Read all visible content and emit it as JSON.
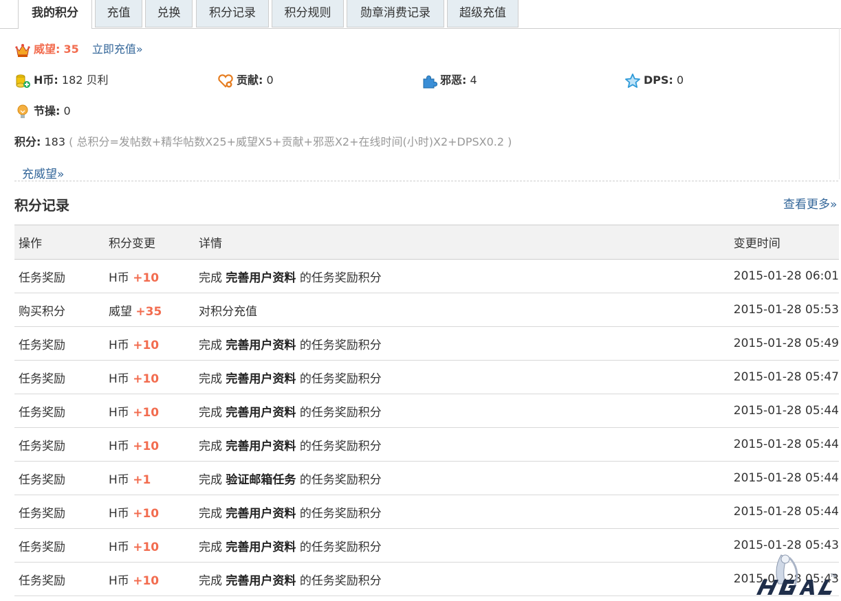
{
  "tabs": [
    "我的积分",
    "充值",
    "兑换",
    "积分记录",
    "积分规则",
    "勋章消费记录",
    "超级充值"
  ],
  "prestige": {
    "label": "威望:",
    "value": "35",
    "link": "立即充值»"
  },
  "credits": [
    {
      "icon": "coins-icon",
      "label": "H币:",
      "value": "182 贝利"
    },
    {
      "icon": "heart-contribution-icon",
      "label": "贡献:",
      "value": "0"
    },
    {
      "icon": "puzzle-icon",
      "label": "邪恶:",
      "value": "4"
    },
    {
      "icon": "star-icon",
      "label": "DPS:",
      "value": "0"
    }
  ],
  "integrity": {
    "icon": "lightbulb-icon",
    "label": "节操:",
    "value": "0"
  },
  "total": {
    "label": "积分:",
    "value": "183",
    "formula": "( 总积分=发帖数+精华帖数X25+威望X5+贡献+邪恶X2+在线时间(小时)X2+DPSX0.2 )"
  },
  "recharge_prestige_link": "充威望»",
  "log": {
    "title": "积分记录",
    "more": "查看更多»",
    "headers": [
      "操作",
      "积分变更",
      "详情",
      "变更时间"
    ],
    "rows": [
      {
        "op": "任务奖励",
        "type": "H币",
        "delta": "+10",
        "pre": "完成",
        "task": "完善用户资料",
        "post": "的任务奖励积分",
        "time": "2015-01-28 06:01"
      },
      {
        "op": "购买积分",
        "type": "威望",
        "delta": "+35",
        "pre": "对积分充值",
        "task": "",
        "post": "",
        "time": "2015-01-28 05:53"
      },
      {
        "op": "任务奖励",
        "type": "H币",
        "delta": "+10",
        "pre": "完成",
        "task": "完善用户资料",
        "post": "的任务奖励积分",
        "time": "2015-01-28 05:49"
      },
      {
        "op": "任务奖励",
        "type": "H币",
        "delta": "+10",
        "pre": "完成",
        "task": "完善用户资料",
        "post": "的任务奖励积分",
        "time": "2015-01-28 05:47"
      },
      {
        "op": "任务奖励",
        "type": "H币",
        "delta": "+10",
        "pre": "完成",
        "task": "完善用户资料",
        "post": "的任务奖励积分",
        "time": "2015-01-28 05:44"
      },
      {
        "op": "任务奖励",
        "type": "H币",
        "delta": "+10",
        "pre": "完成",
        "task": "完善用户资料",
        "post": "的任务奖励积分",
        "time": "2015-01-28 05:44"
      },
      {
        "op": "任务奖励",
        "type": "H币",
        "delta": "+1",
        "pre": "完成",
        "task": "验证邮箱任务",
        "post": "的任务奖励积分",
        "time": "2015-01-28 05:44"
      },
      {
        "op": "任务奖励",
        "type": "H币",
        "delta": "+10",
        "pre": "完成",
        "task": "完善用户资料",
        "post": "的任务奖励积分",
        "time": "2015-01-28 05:44"
      },
      {
        "op": "任务奖励",
        "type": "H币",
        "delta": "+10",
        "pre": "完成",
        "task": "完善用户资料",
        "post": "的任务奖励积分",
        "time": "2015-01-28 05:43"
      },
      {
        "op": "任务奖励",
        "type": "H币",
        "delta": "+10",
        "pre": "完成",
        "task": "完善用户资料",
        "post": "的任务奖励积分",
        "time": "2015-01-28 05:43"
      }
    ]
  },
  "watermark": "HGAL",
  "colors": {
    "accent": "#f26c4f",
    "link": "#336699",
    "tab_bg": "#e5edf2"
  }
}
